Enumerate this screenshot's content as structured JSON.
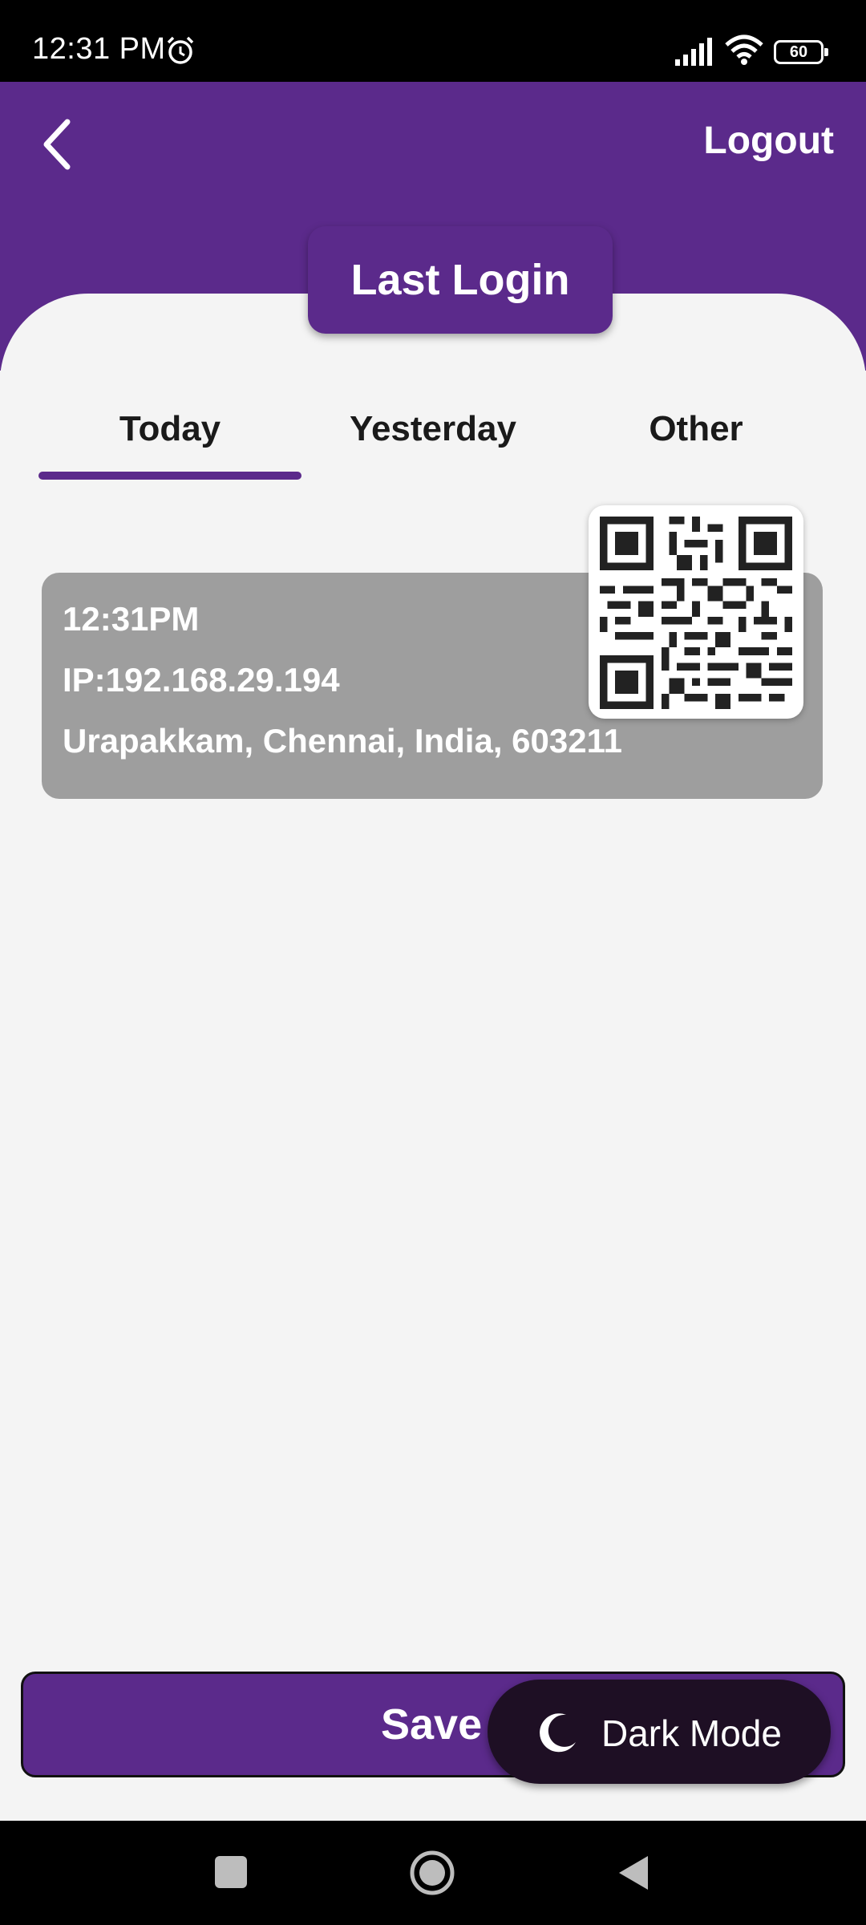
{
  "status_bar": {
    "time": "12:31 PM",
    "battery": "60",
    "icons": [
      "alarm-icon",
      "signal-icon",
      "wifi-icon",
      "battery-icon"
    ]
  },
  "header": {
    "back_icon": "chevron-left-icon",
    "logout_label": "Logout",
    "title": "Last Login"
  },
  "tabs": [
    {
      "label": "Today",
      "selected": true
    },
    {
      "label": "Yesterday",
      "selected": false
    },
    {
      "label": "Other",
      "selected": false
    }
  ],
  "login_entry": {
    "time": "12:31PM",
    "ip": "IP:192.168.29.194",
    "location": "Urapakkam, Chennai, India, 603211",
    "qr_icon": "qr-code-icon"
  },
  "actions": {
    "save_label": "Save",
    "dark_mode_label": "Dark Mode",
    "dark_mode_icon": "moon-icon"
  },
  "nav_bar": {
    "icons": [
      "recents-icon",
      "home-icon",
      "back-icon"
    ]
  },
  "colors": {
    "primary": "#5b2a8b",
    "background": "#f4f4f4",
    "card": "#9e9e9e",
    "dark_button": "#1e0f24"
  }
}
